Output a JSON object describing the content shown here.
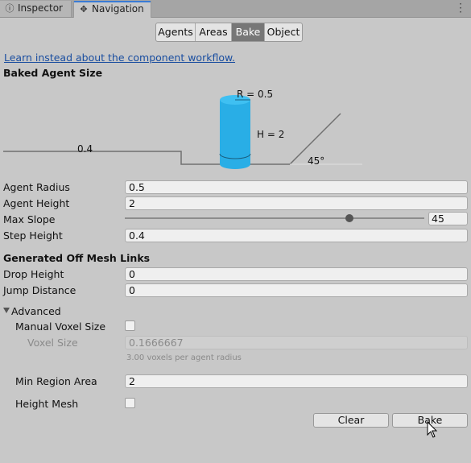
{
  "tabs": [
    {
      "label": "Inspector",
      "icon": "info-icon"
    },
    {
      "label": "Navigation",
      "icon": "navigation-icon"
    }
  ],
  "modes": [
    "Agents",
    "Areas",
    "Bake",
    "Object"
  ],
  "selected_mode": "Bake",
  "link_text": "Learn instead about the component workflow.",
  "baked_agent_size": {
    "header": "Baked Agent Size",
    "radius_label": "R = 0.5",
    "height_label": "H = 2",
    "step_label": "0.4",
    "slope_label": "45°"
  },
  "agent": {
    "radius_label": "Agent Radius",
    "radius_value": "0.5",
    "height_label": "Agent Height",
    "height_value": "2",
    "slope_label": "Max Slope",
    "slope_value": "45",
    "slope_fraction": 0.75,
    "step_label": "Step Height",
    "step_value": "0.4"
  },
  "offmesh": {
    "header": "Generated Off Mesh Links",
    "drop_label": "Drop Height",
    "drop_value": "0",
    "jump_label": "Jump Distance",
    "jump_value": "0"
  },
  "advanced": {
    "header": "Advanced",
    "manual_voxel_label": "Manual Voxel Size",
    "voxel_size_label": "Voxel Size",
    "voxel_size_value": "0.1666667",
    "voxel_hint": "3.00 voxels per agent radius",
    "min_region_label": "Min Region Area",
    "min_region_value": "2",
    "height_mesh_label": "Height Mesh"
  },
  "buttons": {
    "clear": "Clear",
    "bake": "Bake"
  },
  "colors": {
    "accent": "#3a7bd5",
    "cylinder": "#29aee6",
    "selected_mode": "#777777"
  }
}
